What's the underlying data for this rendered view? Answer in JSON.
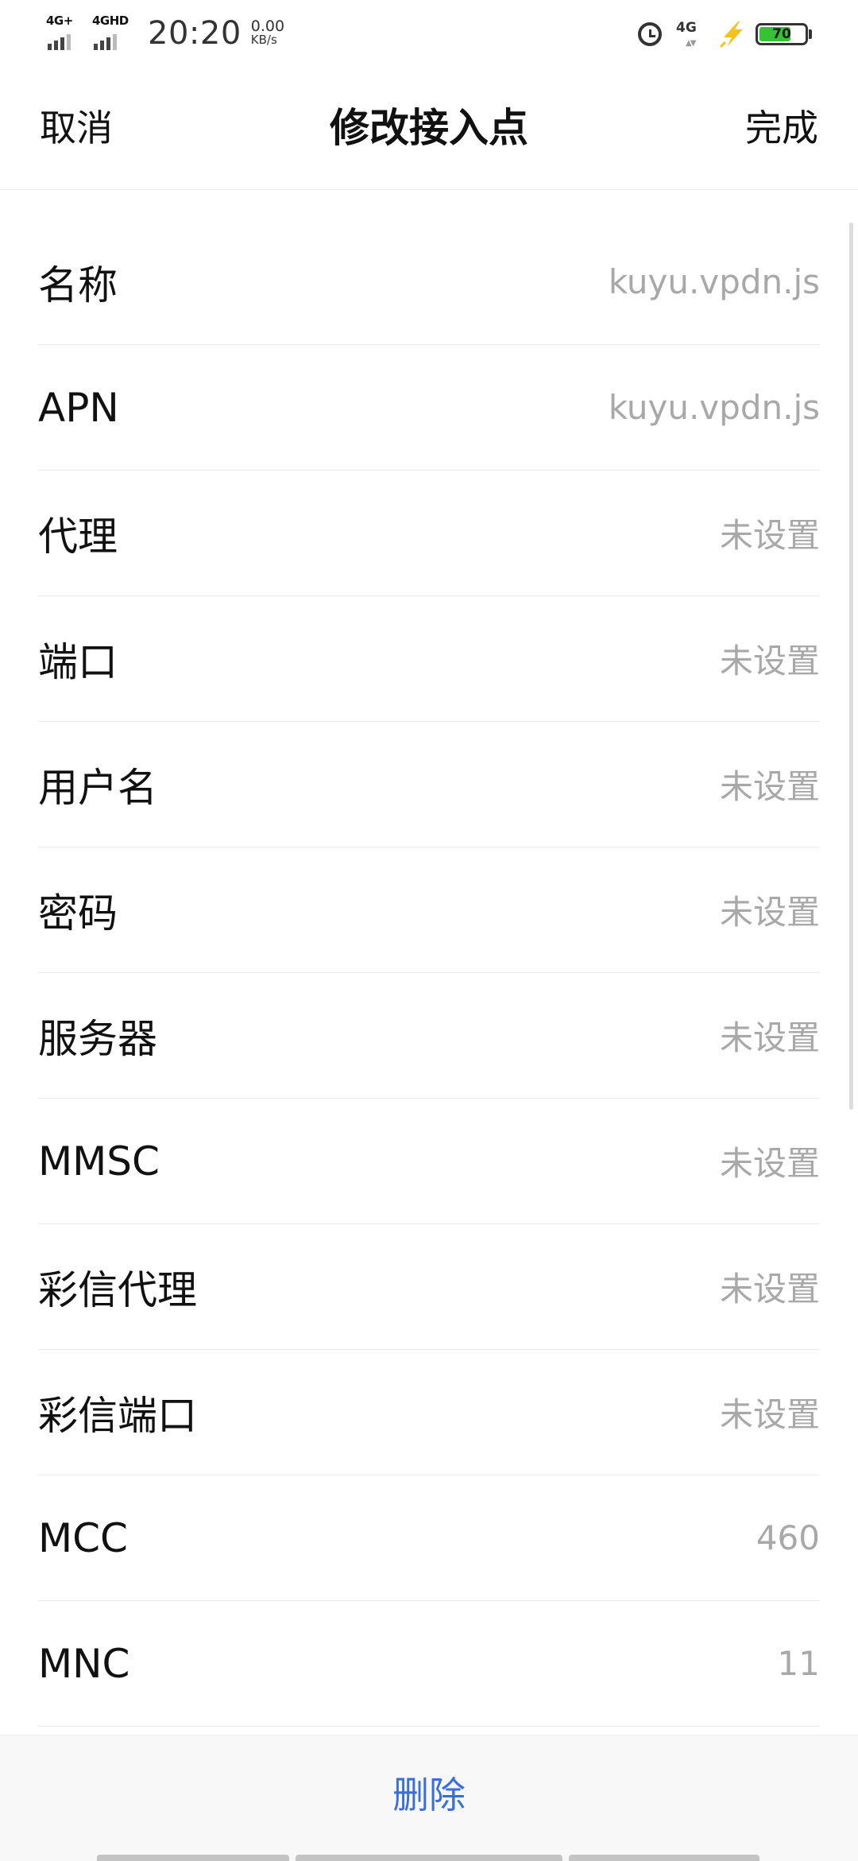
{
  "status_bar": {
    "sim1_network": "4G+",
    "sim2_network": "4GHD",
    "time": "20:20",
    "speed_value": "0.00",
    "speed_unit": "KB/s",
    "mobile_data": "4G",
    "battery_level": "70",
    "battery_fraction": 0.7,
    "battery_color": "#35c234"
  },
  "nav": {
    "cancel_label": "取消",
    "title": "修改接入点",
    "done_label": "完成"
  },
  "fields": [
    {
      "label": "名称",
      "value": "kuyu.vpdn.js"
    },
    {
      "label": "APN",
      "value": "kuyu.vpdn.js"
    },
    {
      "label": "代理",
      "value": "未设置"
    },
    {
      "label": "端口",
      "value": "未设置"
    },
    {
      "label": "用户名",
      "value": "未设置"
    },
    {
      "label": "密码",
      "value": "未设置"
    },
    {
      "label": "服务器",
      "value": "未设置"
    },
    {
      "label": "MMSC",
      "value": "未设置"
    },
    {
      "label": "彩信代理",
      "value": "未设置"
    },
    {
      "label": "彩信端口",
      "value": "未设置"
    },
    {
      "label": "MCC",
      "value": "460"
    },
    {
      "label": "MNC",
      "value": "11"
    }
  ],
  "bottom": {
    "delete_label": "删除",
    "accent_color": "#3a6fd8"
  }
}
